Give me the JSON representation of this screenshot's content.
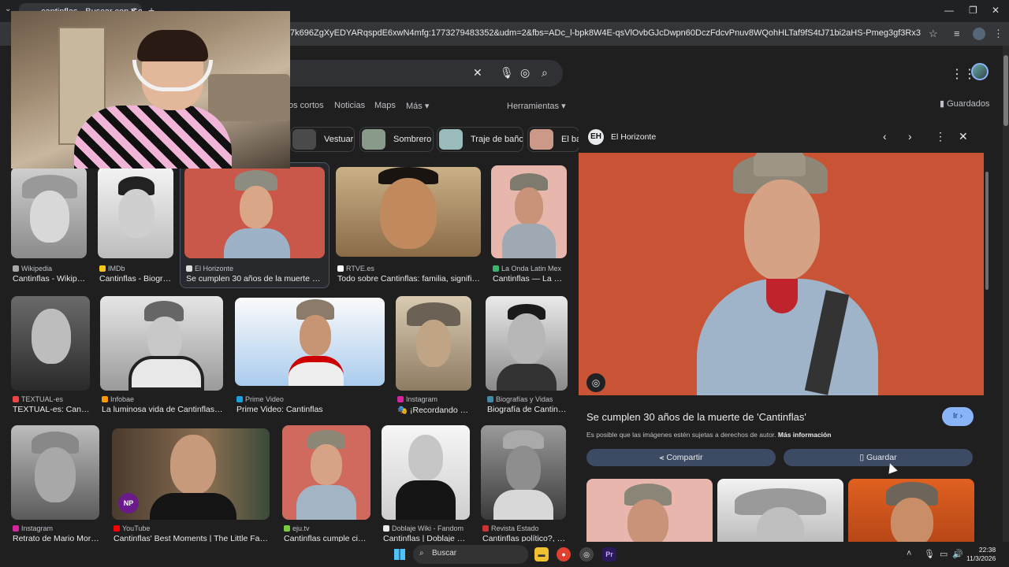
{
  "browser": {
    "tab_title": "cantinflas - Buscar con Google",
    "url": "7k696ZgXyEDYARqspdE6xwN4mfg:1773279483352&udm=2&fbs=ADc_l-bpk8W4E-qsVlOvbGJcDwpn60DczFdcvPnuv8WQohHLTaf9fS4tJ71bi2aHS-Pmeg3gf3Rx3g7wPLd9qB5u5EuZgnwrKvYM0f..."
  },
  "nav": {
    "tabs": [
      "os cortos",
      "Noticias",
      "Maps",
      "Más ▾"
    ],
    "tools": "Herramientas ▾",
    "saved": "Guardados"
  },
  "chips": [
    "Vestuario",
    "Sombrero",
    "Traje de baño",
    "El bar"
  ],
  "rows": [
    [
      {
        "source": "Wikipedia",
        "title": "Cantinflas - Wikipe..."
      },
      {
        "source": "IMDb",
        "title": "Cantinflas - Biogra..."
      },
      {
        "source": "El Horizonte",
        "title": "Se cumplen 30 años de la muerte de '..."
      },
      {
        "source": "RTVE.es",
        "title": "Todo sobre Cantinflas: familia, significa..."
      },
      {
        "source": "La Onda Latin Mex",
        "title": "Cantinflas — La O..."
      }
    ],
    [
      {
        "source": "TEXTUAL-es",
        "title": "TEXTUAL-es: Canti..."
      },
      {
        "source": "Infobae",
        "title": "La luminosa vida de Cantinflas: d..."
      },
      {
        "source": "Prime Video",
        "title": "Prime Video: Cantinflas"
      },
      {
        "source": "Instagram",
        "title": "🎭 ¡Recordando a ..."
      },
      {
        "source": "Biografías y Vidas",
        "title": "Biografía de Cantinfl..."
      }
    ],
    [
      {
        "source": "Instagram",
        "title": "Retrato de Mario More..."
      },
      {
        "source": "YouTube",
        "title": "Cantinflas' Best Moments | The Little Father..."
      },
      {
        "source": "eju.tv",
        "title": "Cantinflas cumple cien..."
      },
      {
        "source": "Doblaje Wiki - Fandom",
        "title": "Cantinflas | Doblaje Wi..."
      },
      {
        "source": "Revista Estado",
        "title": "Cantinflas político?, 'a..."
      }
    ]
  ],
  "panel": {
    "source": "El Horizonte",
    "title": "Se cumplen 30 años de la muerte de 'Cantinflas'",
    "go": "Ir ›",
    "note": "Es posible que las imágenes estén sujetas a derechos de autor.",
    "note_link": "Más información",
    "share": "Compartir",
    "save": "Guardar"
  },
  "taskbar": {
    "search": "Buscar",
    "time": "22:38",
    "date": "11/3/2026"
  },
  "colors": {
    "accent": "#8ab4f8",
    "page_bg": "#1f1f1f",
    "panel_button": "#3c4b63"
  }
}
